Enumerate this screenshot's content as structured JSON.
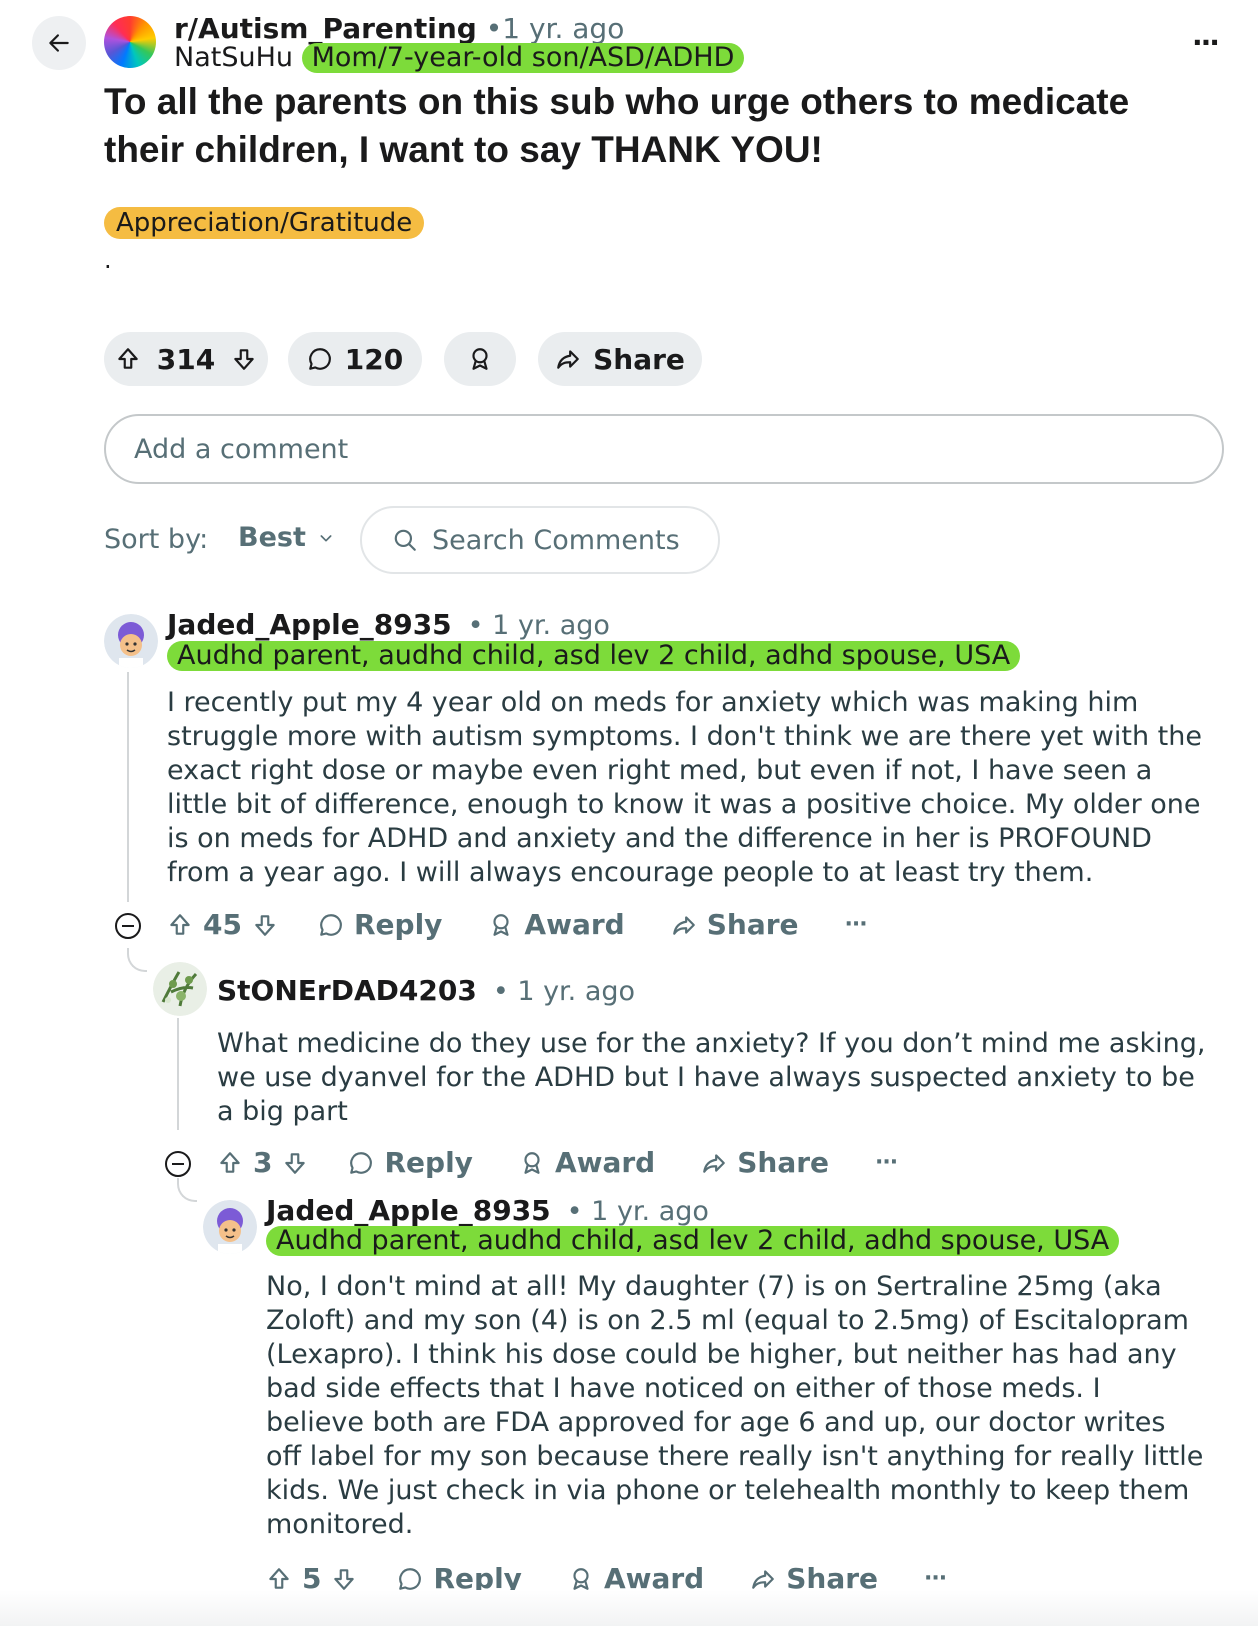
{
  "header": {
    "subreddit": "r/Autism_Parenting",
    "time": "•1 yr. ago",
    "author": "NatSuHu",
    "author_flair": "Mom/7-year-old son/ASD/ADHD"
  },
  "post": {
    "title": "To all the parents on this sub who urge others to medicate their children, I want to say THANK YOU!",
    "tag": "Appreciation/Gratitude",
    "body": ".",
    "upvotes": "314",
    "comments": "120",
    "share_label": "Share"
  },
  "comment_box": {
    "placeholder": "Add a comment"
  },
  "sort": {
    "label": "Sort by:",
    "value": "Best",
    "search_placeholder": "Search Comments"
  },
  "comments": [
    {
      "author": "Jaded_Apple_8935",
      "time": "• 1 yr. ago",
      "flair": "Audhd parent, audhd child, asd lev 2 child, adhd spouse, USA",
      "lines": [
        "I recently put my 4 year old on meds for anxiety which was making him",
        "struggle more with autism symptoms. I don't think we are there yet with the",
        "exact right dose or maybe even right med, but even if not, I have seen a",
        "little bit of difference, enough to know it was a positive choice. My older one",
        "is on meds for ADHD and anxiety and the difference in her is PROFOUND",
        "from a year ago. I will always encourage people to at least try them."
      ],
      "votes": "45",
      "reply": "Reply",
      "award": "Award",
      "share": "Share",
      "more": "···"
    },
    {
      "author": "StONErDAD4203",
      "time": "• 1 yr. ago",
      "lines": [
        "What medicine do they use for the anxiety? If you don’t mind me asking,",
        "we use dyanvel for the ADHD but I have always suspected anxiety to be",
        "a big part"
      ],
      "votes": "3",
      "reply": "Reply",
      "award": "Award",
      "share": "Share",
      "more": "···"
    },
    {
      "author": "Jaded_Apple_8935",
      "time": "• 1 yr. ago",
      "flair": "Audhd parent, audhd child, asd lev 2 child, adhd spouse, USA",
      "lines": [
        "No, I don't mind at all! My daughter (7) is on Sertraline 25mg (aka",
        "Zoloft) and my son (4) is on 2.5 ml (equal to 2.5mg) of Escitalopram",
        "(Lexapro). I think his dose could be higher, but neither has had any",
        "bad side effects that I have noticed on either of those meds. I",
        "believe both are FDA approved for age 6 and up, our doctor writes",
        "off label for my son because there really isn't anything for really little",
        "kids. We just check in via phone or telehealth monthly to keep them",
        "monitored."
      ],
      "votes": "5",
      "reply": "Reply",
      "award": "Award",
      "share": "Share",
      "more": "···"
    }
  ],
  "colors": {
    "user_flair": "#7ddb3a",
    "post_tag": "#f5bc42",
    "muted_text": "#576f76"
  },
  "icons": [
    "back-arrow-icon",
    "upvote-icon",
    "downvote-icon",
    "comment-icon",
    "award-icon",
    "share-icon",
    "search-icon",
    "chevron-down-icon",
    "collapse-icon",
    "more-icon"
  ]
}
